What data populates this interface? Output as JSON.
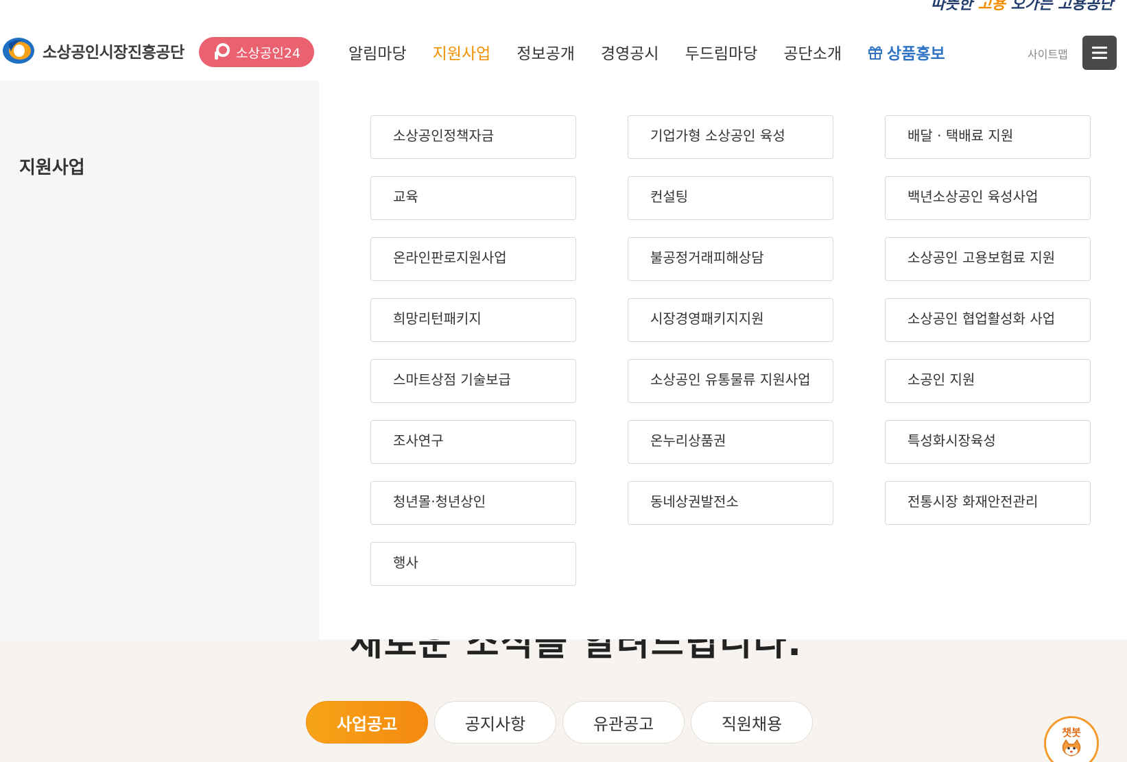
{
  "top_strip": {
    "slogan_prefix": "따뜻한",
    "slogan_highlight": "고용",
    "slogan_suffix": "오가는 고용공단"
  },
  "header": {
    "org_name": "소상공인시장진흥공단",
    "badge_label": "소상공인24",
    "nav": [
      {
        "label": "알림마당",
        "active": false
      },
      {
        "label": "지원사업",
        "active": true
      },
      {
        "label": "정보공개",
        "active": false
      },
      {
        "label": "경영공시",
        "active": false
      },
      {
        "label": "두드림마당",
        "active": false
      },
      {
        "label": "공단소개",
        "active": false
      },
      {
        "label": "상품홍보",
        "active": false,
        "icon": "gift-icon"
      }
    ],
    "sitemap_label": "사이트맵"
  },
  "mega_menu": {
    "title": "지원사업",
    "items": [
      "소상공인정책자금",
      "기업가형 소상공인 육성",
      "배달 · 택배료 지원",
      "교육",
      "컨설팅",
      "백년소상공인 육성사업",
      "온라인판로지원사업",
      "불공정거래피해상담",
      "소상공인 고용보험료 지원",
      "희망리턴패키지",
      "시장경영패키지지원",
      "소상공인 협업활성화 사업",
      "스마트상점 기술보급",
      "소상공인 유통물류 지원사업",
      "소공인 지원",
      "조사연구",
      "온누리상품권",
      "특성화시장육성",
      "청년몰·청년상인",
      "동네상권발전소",
      "전통시장 화재안전관리",
      "행사"
    ]
  },
  "news": {
    "heading": "새로운 소식을 알려드립니다.",
    "tabs": [
      {
        "label": "사업공고",
        "active": true
      },
      {
        "label": "공지사항",
        "active": false
      },
      {
        "label": "유관공고",
        "active": false
      },
      {
        "label": "직원채용",
        "active": false
      }
    ]
  },
  "chatbot": {
    "label": "챗봇"
  },
  "colors": {
    "accent": "#f29000",
    "badge": "#ea6270",
    "promo": "#2f73c4",
    "tab_active": "#f58a10"
  }
}
